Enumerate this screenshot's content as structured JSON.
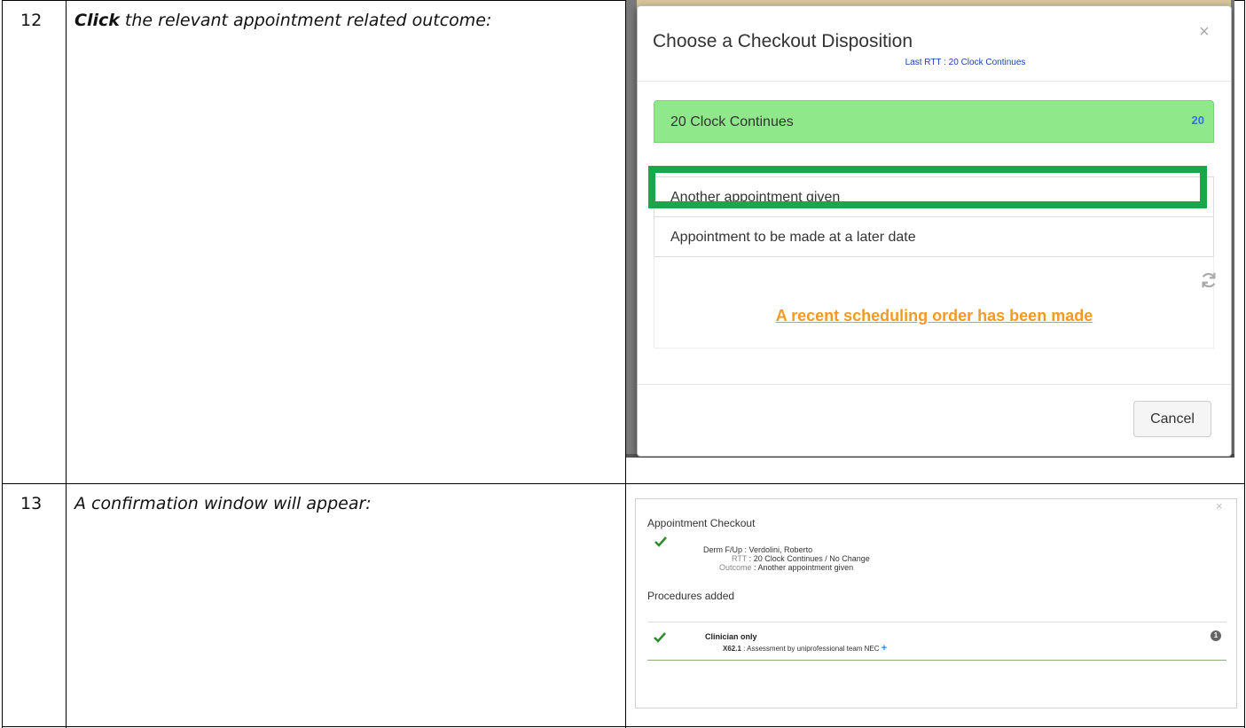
{
  "rows": [
    {
      "step": "12",
      "instruction_bold": "Click",
      "instruction_rest": " the relevant appointment related outcome:"
    },
    {
      "step": "13",
      "instruction": "A confirmation window will appear:"
    }
  ],
  "checkout_modal": {
    "title": "Choose a Checkout Disposition",
    "subtitle": "Last RTT : 20 Clock Continues",
    "close_glyph": "×",
    "active_item": {
      "label": "20 Clock Continues",
      "badge": "20"
    },
    "options": [
      "Another appointment given",
      "Appointment to be made at a later date"
    ],
    "highlighted_option": "Another appointment given",
    "refresh_icon": "refresh-icon",
    "scheduling_link": "A recent scheduling order has been made",
    "cancel_label": "Cancel",
    "colors": {
      "active_bg": "#8fe98b",
      "highlight_border": "#1ca64a",
      "link": "#f29a24",
      "badge": "#3a6fd8"
    }
  },
  "confirmation": {
    "close_glyph": "×",
    "title": "Appointment Checkout",
    "lines": [
      {
        "key": "Derm F/Up",
        "value": "Verdolini, Roberto"
      },
      {
        "key": "RTT",
        "value": "20 Clock Continues / No Change"
      },
      {
        "key": "Outcome",
        "value": "Another appointment given"
      }
    ],
    "separator": " : ",
    "procedures_label": "Procedures added",
    "procedure_group": "Clinician only",
    "procedure_code": "X62.1",
    "procedure_desc": "Assessment by uniprofessional team NEC",
    "plus_glyph": "+",
    "count_badge": "1",
    "colors": {
      "check": "#2e8b2e",
      "plus": "#2a86e0"
    }
  }
}
